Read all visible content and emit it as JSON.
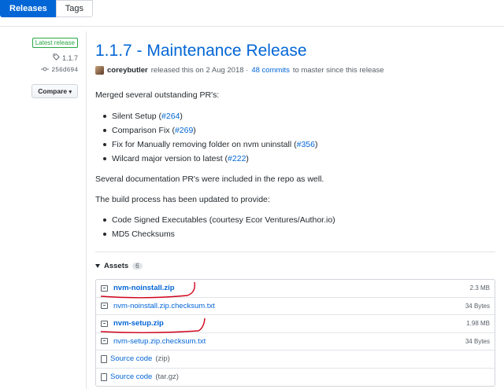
{
  "tabs": [
    {
      "label": "Releases",
      "active": true
    },
    {
      "label": "Tags",
      "active": false
    }
  ],
  "sidebar": {
    "badge": "Latest release",
    "tag": "1.1.7",
    "commit": "256d694",
    "compare_label": "Compare"
  },
  "release": {
    "title": "1.1.7 - Maintenance Release",
    "author": "coreybutler",
    "released_text": "released this on 2 Aug 2018 ·",
    "commits_link": "48 commits",
    "commits_suffix": "to master since this release",
    "intro": "Merged several outstanding PR's:",
    "prs": [
      {
        "text": "Silent Setup (",
        "ref": "#264",
        "close": ")"
      },
      {
        "text": "Comparison Fix (",
        "ref": "#269",
        "close": ")"
      },
      {
        "text": "Fix for Manually removing folder on nvm uninstall (",
        "ref": "#356",
        "close": ")"
      },
      {
        "text": "Wilcard major version to latest (",
        "ref": "#222",
        "close": ")"
      }
    ],
    "docs_note": "Several documentation PR's were included in the repo as well.",
    "build_intro": "The build process has been updated to provide:",
    "build_items": [
      "Code Signed Executables (courtesy Ecor Ventures/Author.io)",
      "MD5 Checksums"
    ]
  },
  "assets": {
    "label": "Assets",
    "count": "6",
    "files": [
      {
        "name": "nvm-noinstall.zip",
        "size": "2.3 MB"
      },
      {
        "name": "nvm-noinstall.zip.checksum.txt",
        "size": "34 Bytes"
      },
      {
        "name": "nvm-setup.zip",
        "size": "1.98 MB"
      },
      {
        "name": "nvm-setup.zip.checksum.txt",
        "size": "34 Bytes"
      }
    ],
    "sources": [
      {
        "label": "Source code",
        "format": "(zip)"
      },
      {
        "label": "Source code",
        "format": "(tar.gz)"
      }
    ]
  },
  "colors": {
    "accent": "#0366d6",
    "latest": "#28a745",
    "annotation": "#d0021b"
  }
}
